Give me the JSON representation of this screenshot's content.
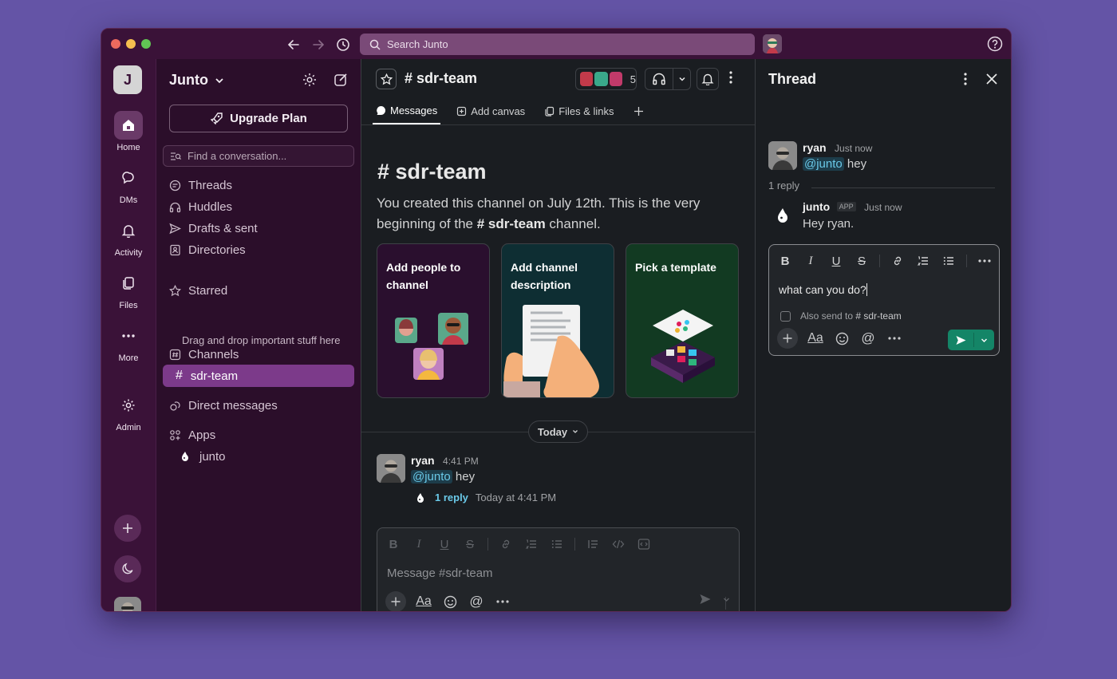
{
  "search": {
    "placeholder": "Search Junto"
  },
  "rail": {
    "workspace_initial": "J",
    "items": [
      {
        "label": "Home",
        "icon": "home-icon"
      },
      {
        "label": "DMs",
        "icon": "dm-icon"
      },
      {
        "label": "Activity",
        "icon": "bell-icon"
      },
      {
        "label": "Files",
        "icon": "files-icon"
      },
      {
        "label": "More",
        "icon": "more-icon"
      },
      {
        "label": "Admin",
        "icon": "gear-icon"
      }
    ]
  },
  "sidebar": {
    "workspace_name": "Junto",
    "upgrade_label": "Upgrade Plan",
    "find_placeholder": "Find a conversation...",
    "nav": [
      "Threads",
      "Huddles",
      "Drafts & sent",
      "Directories"
    ],
    "starred_label": "Starred",
    "starred_hint": "Drag and drop important stuff here",
    "channels_label": "Channels",
    "active_channel": "sdr-team",
    "dms_label": "Direct messages",
    "apps_label": "Apps",
    "app_item": "junto"
  },
  "channel": {
    "name": "sdr-team",
    "member_count": "5",
    "tabs": [
      "Messages",
      "Add canvas",
      "Files & links"
    ],
    "title": "sdr-team",
    "intro_before": "You created this channel on July 12th. This is the very beginning of the ",
    "intro_channel": "# sdr-team",
    "intro_after": " channel.",
    "cards": [
      {
        "title": "Add people to channel",
        "bg": "#2a0f2e"
      },
      {
        "title": "Add channel description",
        "bg": "#0e2e33"
      },
      {
        "title": "Pick a template",
        "bg": "#123a22"
      }
    ],
    "date_divider": "Today",
    "message": {
      "author": "ryan",
      "time": "4:41 PM",
      "mention": "@junto",
      "text": " hey",
      "reply_count": "1 reply",
      "reply_time": "Today at 4:41 PM"
    },
    "composer_placeholder": "Message #sdr-team"
  },
  "thread": {
    "title": "Thread",
    "parent": {
      "author": "ryan",
      "time": "Just now",
      "mention": "@junto",
      "text": " hey"
    },
    "reply_count": "1 reply",
    "reply": {
      "author": "junto",
      "badge": "APP",
      "time": "Just now",
      "text": "Hey ryan."
    },
    "composer_text": "what can you do?",
    "also_send_label": "Also send to",
    "also_send_channel": "# sdr-team"
  },
  "colors": {
    "accent": "#7c3a8a",
    "send": "#148567",
    "background": "#6454a6"
  }
}
